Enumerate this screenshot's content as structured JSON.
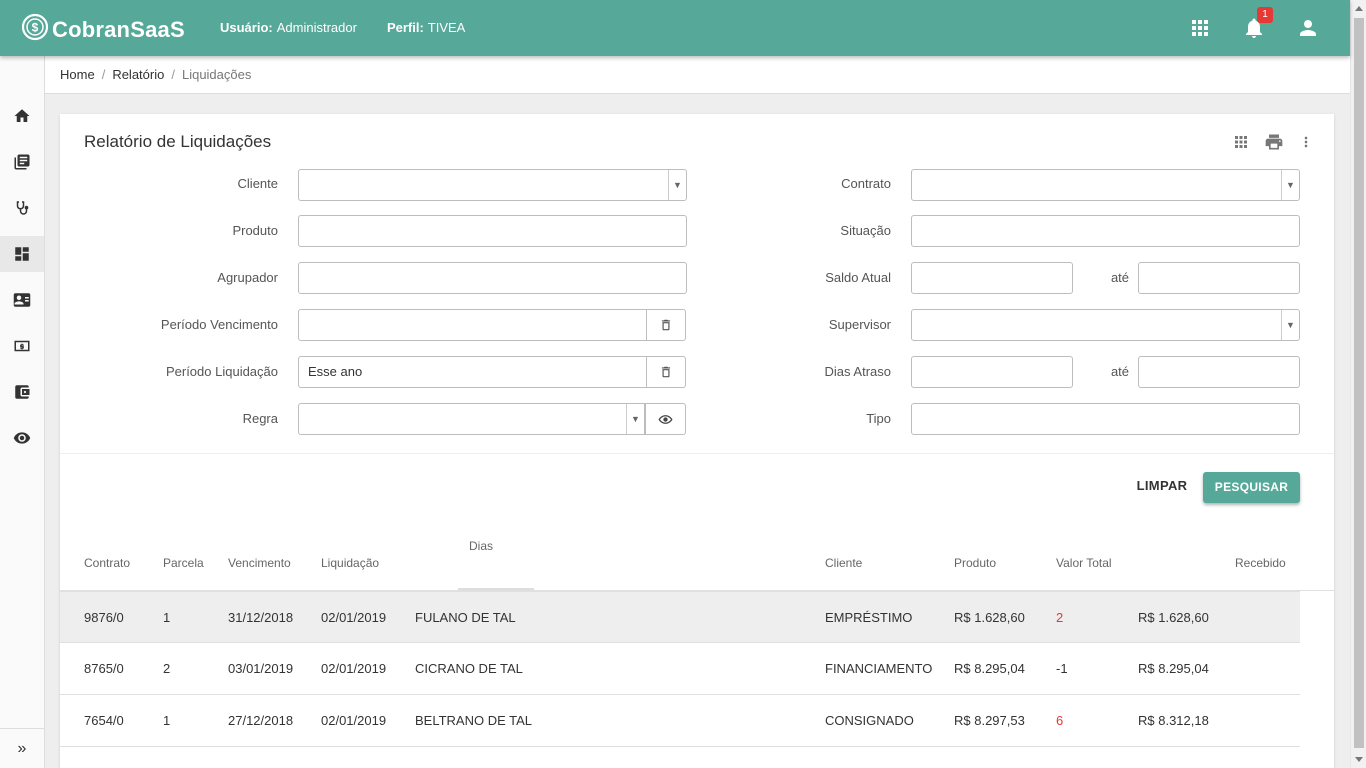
{
  "app": {
    "name": "CobranSaaS",
    "user_label": "Usuário:",
    "user_value": "Administrador",
    "profile_label": "Perfil:",
    "profile_value": "TIVEA",
    "notification_count": "1",
    "brand_color": "#56a899"
  },
  "sidebar": {
    "items": [
      {
        "icon": "home-icon"
      },
      {
        "icon": "book-icon"
      },
      {
        "icon": "stethoscope-icon"
      },
      {
        "icon": "dashboard-icon",
        "active": true
      },
      {
        "icon": "contact-card-icon"
      },
      {
        "icon": "money-icon"
      },
      {
        "icon": "wallet-icon"
      },
      {
        "icon": "eye-icon"
      }
    ],
    "expand_icon": "»"
  },
  "breadcrumb": {
    "items": [
      "Home",
      "Relatório",
      "Liquidações"
    ]
  },
  "report": {
    "title": "Relatório de Liquidações"
  },
  "filters": {
    "cliente": {
      "label": "Cliente",
      "value": ""
    },
    "produto": {
      "label": "Produto",
      "value": ""
    },
    "agrupador": {
      "label": "Agrupador",
      "value": ""
    },
    "periodo_vencimento": {
      "label": "Período Vencimento",
      "value": ""
    },
    "periodo_liquidacao": {
      "label": "Período Liquidação",
      "value": "Esse ano"
    },
    "regra": {
      "label": "Regra",
      "value": ""
    },
    "contrato": {
      "label": "Contrato",
      "value": ""
    },
    "situacao": {
      "label": "Situação",
      "value": ""
    },
    "saldo_atual": {
      "label": "Saldo Atual",
      "from": "",
      "to": ""
    },
    "supervisor": {
      "label": "Supervisor",
      "value": ""
    },
    "dias_atraso": {
      "label": "Dias Atraso",
      "from": "",
      "to": ""
    },
    "tipo": {
      "label": "Tipo",
      "value": ""
    },
    "ate_label": "até"
  },
  "actions": {
    "clear_label": "LIMPAR",
    "search_label": "PESQUISAR"
  },
  "table": {
    "headers": {
      "contrato": "Contrato",
      "parcela": "Parcela",
      "vencimento": "Vencimento",
      "liquidacao": "Liquidação",
      "dias": "Dias",
      "cliente": "Cliente",
      "produto": "Produto",
      "valor_total": "Valor Total",
      "recebido": "Recebido"
    },
    "rows": [
      {
        "contrato": "9876/0",
        "parcela": "1",
        "vencimento": "31/12/2018",
        "liquidacao": "02/01/2019",
        "nome": "FULANO DE TAL",
        "produto": "EMPRÉSTIMO",
        "valor": "R$ 1.628,60",
        "dias": "2",
        "dias_red": true,
        "recebido": "R$ 1.628,60"
      },
      {
        "contrato": "8765/0",
        "parcela": "2",
        "vencimento": "03/01/2019",
        "liquidacao": "02/01/2019",
        "nome": "CICRANO DE TAL",
        "produto": "FINANCIAMENTO",
        "valor": "R$ 8.295,04",
        "dias": "-1",
        "dias_red": false,
        "recebido": "R$ 8.295,04"
      },
      {
        "contrato": "7654/0",
        "parcela": "1",
        "vencimento": "27/12/2018",
        "liquidacao": "02/01/2019",
        "nome": "BELTRANO DE TAL",
        "produto": "CONSIGNADO",
        "valor": "R$ 8.297,53",
        "dias": "6",
        "dias_red": true,
        "recebido": "R$ 8.312,18"
      }
    ]
  }
}
